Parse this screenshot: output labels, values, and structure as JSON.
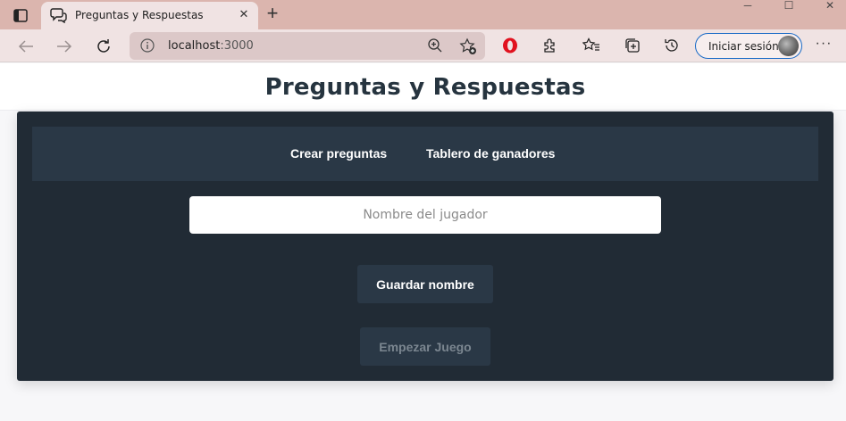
{
  "browser": {
    "tab": {
      "title": "Preguntas y Respuestas"
    },
    "address": {
      "host": "localhost",
      "port": ":3000"
    },
    "signin_label": "Iniciar sesión"
  },
  "page": {
    "title": "Preguntas y Respuestas",
    "menu": [
      {
        "label": "Crear preguntas"
      },
      {
        "label": "Tablero de ganadores"
      }
    ],
    "player_input": {
      "placeholder": "Nombre del jugador",
      "value": ""
    },
    "save_button": "Guardar nombre",
    "start_button": "Empezar Juego"
  },
  "colors": {
    "tabbar": "#dbb5ae",
    "toolbar": "#f0e3e3",
    "card": "#212b35",
    "menu": "#2a3846",
    "title": "#26343f",
    "signin_border": "#1b6bc7"
  },
  "icons": [
    "window-icon",
    "tab-chat-icon",
    "close-icon",
    "plus-icon",
    "back-arrow-icon",
    "forward-arrow-icon",
    "refresh-icon",
    "info-icon",
    "zoom-icon",
    "add-favorite-icon",
    "opera-icon",
    "extensions-icon",
    "favorites-icon",
    "collections-icon",
    "history-icon",
    "more-icon"
  ]
}
